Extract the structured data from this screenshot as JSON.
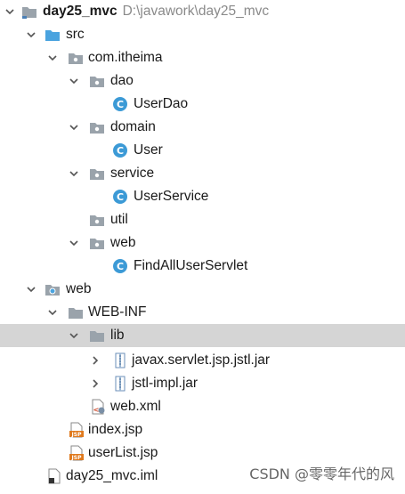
{
  "project": {
    "name": "day25_mvc",
    "path": "D:\\javawork\\day25_mvc"
  },
  "tree": {
    "src": "src",
    "package": "com.itheima",
    "dao": "dao",
    "user_dao": "UserDao",
    "domain": "domain",
    "user": "User",
    "service": "service",
    "user_service": "UserService",
    "util": "util",
    "web_pkg": "web",
    "find_all_servlet": "FindAllUserServlet",
    "web_root": "web",
    "web_inf": "WEB-INF",
    "lib": "lib",
    "jar_jstl_api": "javax.servlet.jsp.jstl.jar",
    "jar_jstl_impl": "jstl-impl.jar",
    "web_xml": "web.xml",
    "index_jsp": "index.jsp",
    "user_list_jsp": "userList.jsp",
    "iml_file": "day25_mvc.iml"
  },
  "watermark": "CSDN @零零年代的风",
  "colors": {
    "selected_row": "#d5d5d5",
    "folder_gray": "#9aa3ab",
    "folder_blue": "#4aa3df",
    "class_icon": "#3c9ad6",
    "jsp_icon": "#e07a1e"
  }
}
